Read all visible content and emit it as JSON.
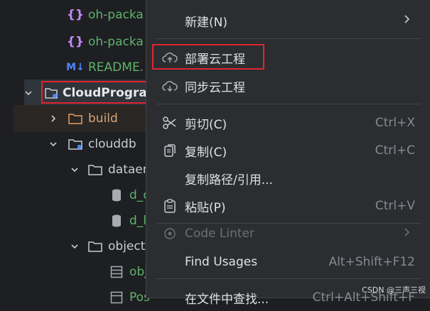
{
  "tree": {
    "items": [
      {
        "label": "oh-packa",
        "icon": "json-braces-icon"
      },
      {
        "label": "oh-packa",
        "icon": "json-braces-icon"
      },
      {
        "label": "README.",
        "icon": "markdown-icon",
        "badge": "M↓"
      },
      {
        "label": "CloudProgra",
        "icon": "cloud-folder-icon"
      },
      {
        "label": "build",
        "icon": "folder-icon"
      },
      {
        "label": "clouddb",
        "icon": "database-folder-icon"
      },
      {
        "label": "dataen",
        "icon": "folder-icon"
      },
      {
        "label": "d_c",
        "icon": "database-icon"
      },
      {
        "label": "d_l",
        "icon": "database-icon"
      },
      {
        "label": "object",
        "icon": "folder-icon"
      },
      {
        "label": "obj",
        "icon": "table-icon"
      },
      {
        "label": "Pos",
        "icon": "table-icon"
      }
    ]
  },
  "menu": {
    "new": {
      "label": "新建(N)"
    },
    "deploy": {
      "label": "部署云工程"
    },
    "sync": {
      "label": "同步云工程"
    },
    "cut": {
      "label": "剪切(C)",
      "shortcut": "Ctrl+X"
    },
    "copy": {
      "label": "复制(C)",
      "shortcut": "Ctrl+C"
    },
    "copy_path": {
      "label": "复制路径/引用..."
    },
    "paste": {
      "label": "粘贴(P)",
      "shortcut": "Ctrl+V"
    },
    "code_linter": {
      "label": "Code Linter"
    },
    "find_usages": {
      "label": "Find Usages",
      "shortcut": "Alt+Shift+F12"
    },
    "find_in_files": {
      "label": "在文件中查找...",
      "shortcut": "Ctrl+Alt+Shift+F"
    }
  },
  "watermark": "CSDN @三声三视"
}
